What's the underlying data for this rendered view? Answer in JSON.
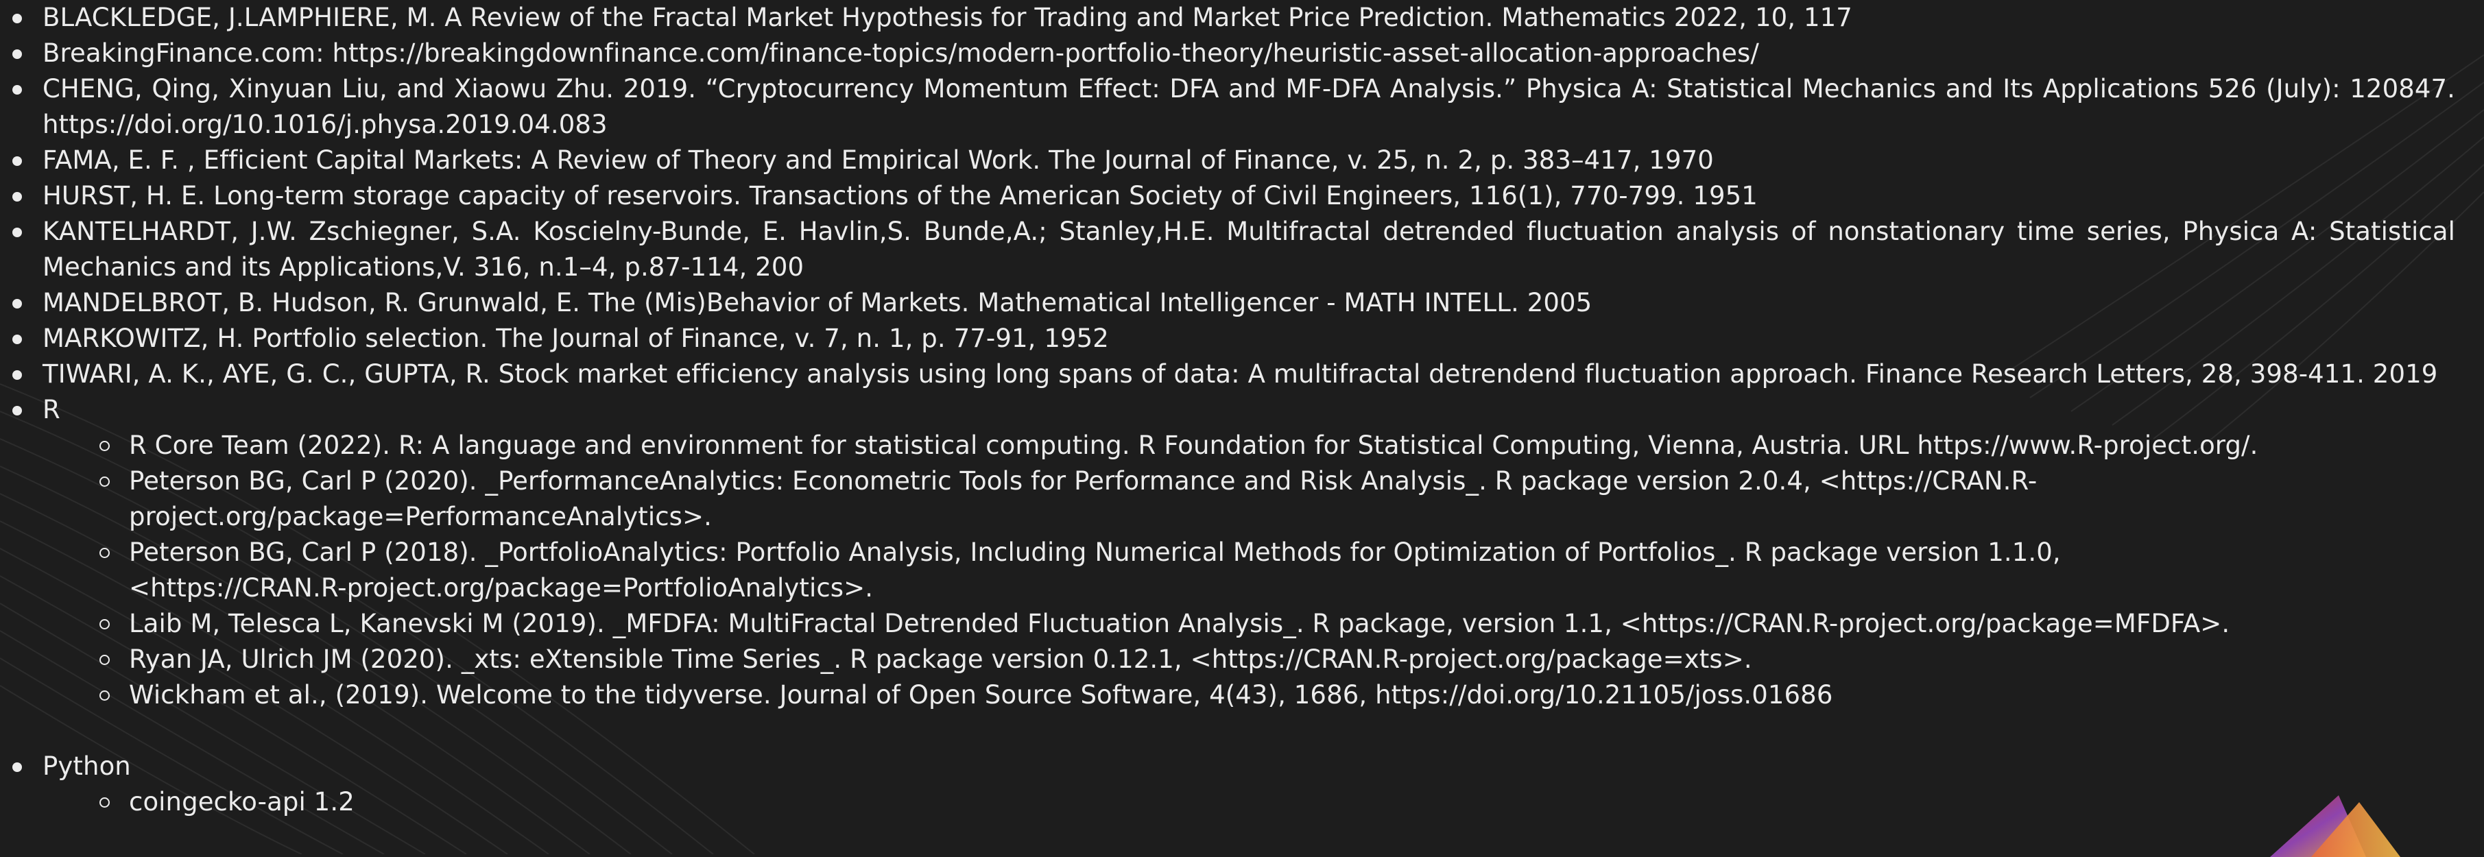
{
  "references": [
    {
      "text": "BLACKLEDGE, J.LAMPHIERE, M. A Review of the Fractal Market Hypothesis for Trading and Market Price Prediction. Mathematics 2022, 10, 117"
    },
    {
      "text": "BreakingFinance.com: https://breakingdownfinance.com/finance-topics/modern-portfolio-theory/heuristic-asset-allocation-approaches/"
    },
    {
      "text": "CHENG, Qing, Xinyuan Liu, and Xiaowu Zhu. 2019. “Cryptocurrency Momentum Effect: DFA and MF-DFA Analysis.” Physica A: Statistical Mechanics and Its Applications 526 (July): 120847. https://doi.org/10.1016/j.physa.2019.04.083"
    },
    {
      "text": "FAMA, E. F. , Efficient Capital Markets: A Review of Theory and Empirical Work. The Journal of Finance, v. 25, n. 2, p. 383–417, 1970"
    },
    {
      "text": "HURST, H. E. Long-term storage capacity of reservoirs. Transactions of the American Society of Civil Engineers, 116(1), 770-799. 1951"
    },
    {
      "text": "KANTELHARDT, J.W. Zschiegner, S.A. Koscielny-Bunde, E. Havlin,S. Bunde,A.; Stanley,H.E. Multifractal detrended fluctuation analysis of nonstationary time series, Physica A: Statistical Mechanics and its Applications,V. 316, n.1–4, p.87-114, 200"
    },
    {
      "text": "MANDELBROT, B. Hudson, R. Grunwald, E. The (Mis)Behavior of Markets. Mathematical Intelligencer - MATH INTELL. 2005"
    },
    {
      "text": "MARKOWITZ, H. Portfolio selection. The Journal of Finance, v. 7, n. 1, p. 77-91, 1952"
    },
    {
      "text": "TIWARI, A. K., AYE, G. C., GUPTA, R. Stock market efficiency analysis using long spans of data: A multifractal detrendend fluctuation approach. Finance Research Letters, 28, 398-411. 2019"
    }
  ],
  "r_section": {
    "label": "R",
    "items": [
      "R Core Team (2022). R: A language and environment for statistical computing. R Foundation for Statistical Computing, Vienna, Austria. URL https://www.R-project.org/.",
      "Peterson BG, Carl P (2020). _PerformanceAnalytics: Econometric Tools for Performance and Risk Analysis_. R package version 2.0.4, <https://CRAN.R-project.org/package=PerformanceAnalytics>.",
      "Peterson BG, Carl P (2018). _PortfolioAnalytics: Portfolio Analysis, Including Numerical Methods for Optimization of Portfolios_. R package version 1.1.0, <https://CRAN.R-project.org/package=PortfolioAnalytics>.",
      "Laib M, Telesca L, Kanevski M (2019). _MFDFA: MultiFractal Detrended Fluctuation Analysis_. R package, version 1.1, <https://CRAN.R-project.org/package=MFDFA>.",
      "Ryan JA, Ulrich JM (2020). _xts: eXtensible Time Series_. R package version 0.12.1, <https://CRAN.R-project.org/package=xts>.",
      "Wickham et al., (2019). Welcome to the tidyverse. Journal of Open Source Software, 4(43), 1686, https://doi.org/10.21105/joss.01686"
    ]
  },
  "python_section": {
    "label": "Python",
    "items": [
      "coingecko-api 1.2"
    ]
  },
  "colors": {
    "background": "#1d1d1d",
    "text": "#ececec",
    "logo_gradient_start": "#c0392b",
    "logo_gradient_mid": "#8e44ad",
    "logo_gradient_end": "#e0a040"
  },
  "icons": {
    "logo": "triangle-logo-icon"
  }
}
